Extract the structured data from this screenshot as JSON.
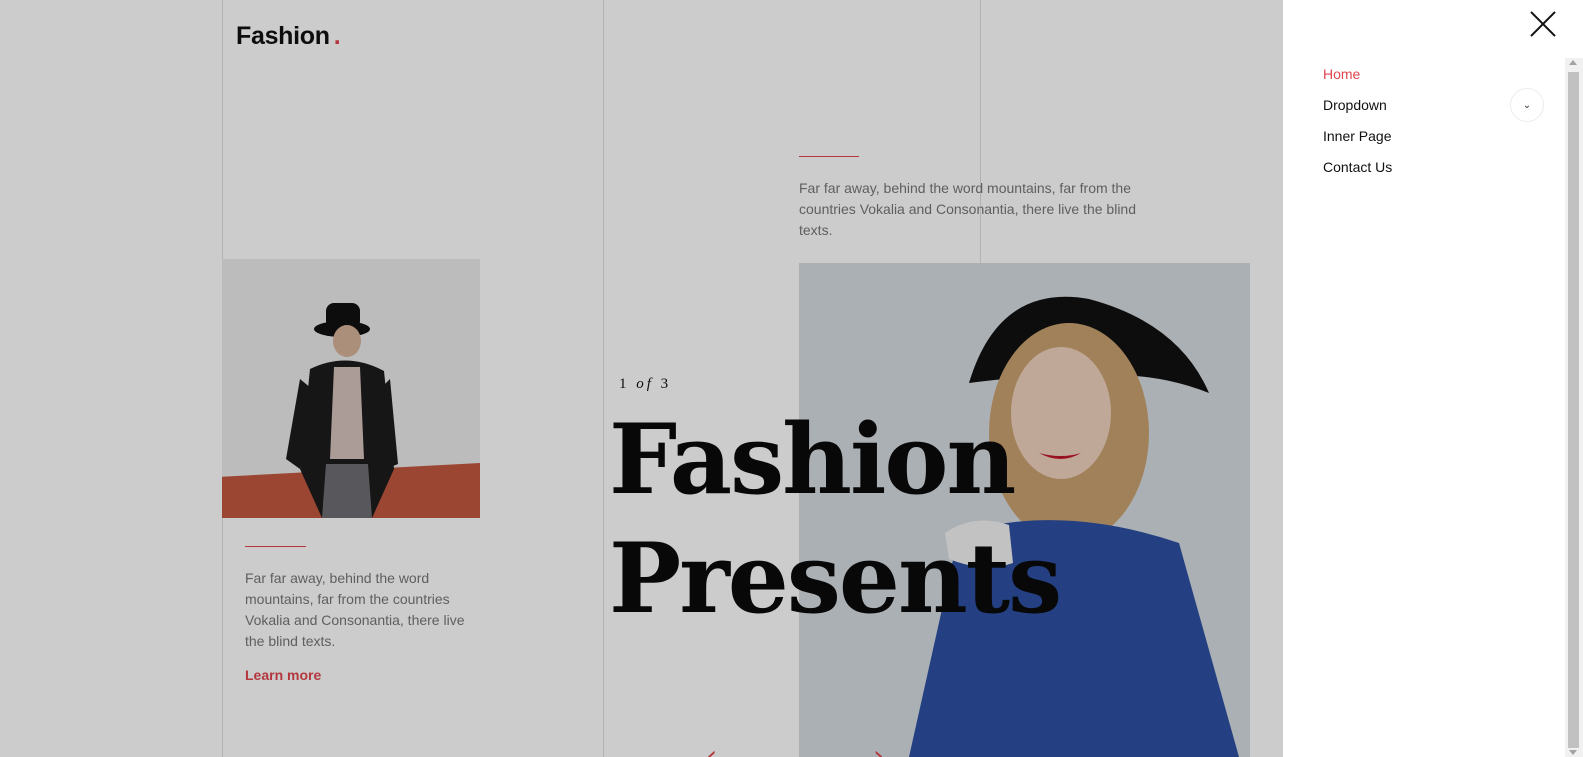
{
  "header": {
    "logo_text": "Fashion",
    "logo_dot": "."
  },
  "intro": {
    "paragraph": "Far far away, behind the word mountains, far from the countries Vokalia and Consonantia, there live the blind texts."
  },
  "feature": {
    "paragraph": "Far far away, behind the word mountains, far from the countries Vokalia and Consonantia, there live the blind texts.",
    "link_label": "Learn more"
  },
  "slider": {
    "current": "1",
    "of_word": "of",
    "total": "3",
    "title_line1": "Fashion",
    "title_line2": "Presents",
    "prev_symbol": "‹",
    "next_symbol": "›"
  },
  "menu": {
    "items": [
      {
        "label": "Home",
        "active": true
      },
      {
        "label": "Dropdown"
      },
      {
        "label": "Inner Page"
      },
      {
        "label": "Contact Us"
      }
    ],
    "dropdown_toggle_symbol": "⌄"
  },
  "colors": {
    "accent": "#e0464e",
    "overlay": "rgba(0,0,0,0.2)",
    "panel": "#ffffff"
  },
  "icons": [
    "close-icon",
    "chevron-down-icon",
    "arrow-left-icon",
    "arrow-right-icon"
  ]
}
